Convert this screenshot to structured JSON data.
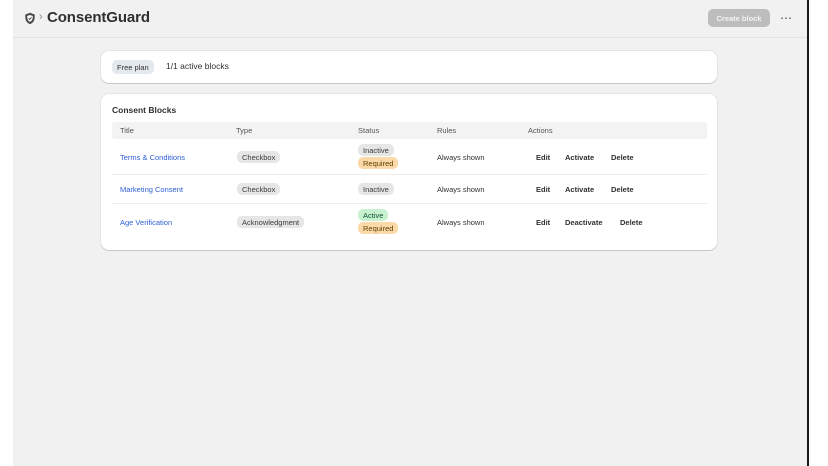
{
  "header": {
    "app_icon": "shield-icon",
    "separator": "›",
    "title": "ConsentGuard",
    "create_button": "Create block",
    "more_icon": "⋯"
  },
  "plan": {
    "badge": "Free plan",
    "text": "1/1 active blocks"
  },
  "blocks": {
    "section_title": "Consent Blocks",
    "columns": [
      "Title",
      "Type",
      "Status",
      "Rules",
      "Actions"
    ],
    "rows": [
      {
        "title": "Terms & Conditions",
        "type": "Checkbox",
        "status": "Inactive",
        "required": "Required",
        "rules": "Always shown",
        "actions": [
          "Edit",
          "Activate",
          "Delete"
        ]
      },
      {
        "title": "Marketing Consent",
        "type": "Checkbox",
        "status": "Inactive",
        "required": "",
        "rules": "Always shown",
        "actions": [
          "Edit",
          "Activate",
          "Delete"
        ]
      },
      {
        "title": "Age Verification",
        "type": "Acknowledgment",
        "status": "Active",
        "required": "Required",
        "rules": "Always shown",
        "actions": [
          "Edit",
          "Deactivate",
          "Delete"
        ]
      }
    ]
  },
  "colors": {
    "link": "#2c5fd1",
    "required_badge": "#fbd9a9",
    "active_badge": "#c8f2cf",
    "inactive_badge": "#e6e6e6",
    "create_button_disabled": "#bdbdbd"
  }
}
